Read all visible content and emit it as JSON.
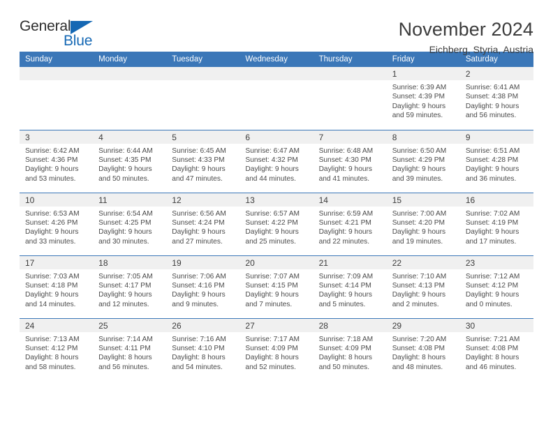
{
  "brand": {
    "name_dark": "General",
    "name_blue": "Blue",
    "triangle_icon": "triangle-icon",
    "accent_color": "#1568b4"
  },
  "header": {
    "title": "November 2024",
    "subtitle": "Eichberg, Styria, Austria",
    "header_bg_color": "#3b77b8",
    "daynum_bg_color": "#f0f0f0"
  },
  "weekdays": [
    "Sunday",
    "Monday",
    "Tuesday",
    "Wednesday",
    "Thursday",
    "Friday",
    "Saturday"
  ],
  "weeks": [
    [
      {
        "day": "",
        "empty": true
      },
      {
        "day": "",
        "empty": true
      },
      {
        "day": "",
        "empty": true
      },
      {
        "day": "",
        "empty": true
      },
      {
        "day": "",
        "empty": true
      },
      {
        "day": "1",
        "sunrise": "Sunrise: 6:39 AM",
        "sunset": "Sunset: 4:39 PM",
        "daylight_1": "Daylight: 9 hours",
        "daylight_2": "and 59 minutes."
      },
      {
        "day": "2",
        "sunrise": "Sunrise: 6:41 AM",
        "sunset": "Sunset: 4:38 PM",
        "daylight_1": "Daylight: 9 hours",
        "daylight_2": "and 56 minutes."
      }
    ],
    [
      {
        "day": "3",
        "sunrise": "Sunrise: 6:42 AM",
        "sunset": "Sunset: 4:36 PM",
        "daylight_1": "Daylight: 9 hours",
        "daylight_2": "and 53 minutes."
      },
      {
        "day": "4",
        "sunrise": "Sunrise: 6:44 AM",
        "sunset": "Sunset: 4:35 PM",
        "daylight_1": "Daylight: 9 hours",
        "daylight_2": "and 50 minutes."
      },
      {
        "day": "5",
        "sunrise": "Sunrise: 6:45 AM",
        "sunset": "Sunset: 4:33 PM",
        "daylight_1": "Daylight: 9 hours",
        "daylight_2": "and 47 minutes."
      },
      {
        "day": "6",
        "sunrise": "Sunrise: 6:47 AM",
        "sunset": "Sunset: 4:32 PM",
        "daylight_1": "Daylight: 9 hours",
        "daylight_2": "and 44 minutes."
      },
      {
        "day": "7",
        "sunrise": "Sunrise: 6:48 AM",
        "sunset": "Sunset: 4:30 PM",
        "daylight_1": "Daylight: 9 hours",
        "daylight_2": "and 41 minutes."
      },
      {
        "day": "8",
        "sunrise": "Sunrise: 6:50 AM",
        "sunset": "Sunset: 4:29 PM",
        "daylight_1": "Daylight: 9 hours",
        "daylight_2": "and 39 minutes."
      },
      {
        "day": "9",
        "sunrise": "Sunrise: 6:51 AM",
        "sunset": "Sunset: 4:28 PM",
        "daylight_1": "Daylight: 9 hours",
        "daylight_2": "and 36 minutes."
      }
    ],
    [
      {
        "day": "10",
        "sunrise": "Sunrise: 6:53 AM",
        "sunset": "Sunset: 4:26 PM",
        "daylight_1": "Daylight: 9 hours",
        "daylight_2": "and 33 minutes."
      },
      {
        "day": "11",
        "sunrise": "Sunrise: 6:54 AM",
        "sunset": "Sunset: 4:25 PM",
        "daylight_1": "Daylight: 9 hours",
        "daylight_2": "and 30 minutes."
      },
      {
        "day": "12",
        "sunrise": "Sunrise: 6:56 AM",
        "sunset": "Sunset: 4:24 PM",
        "daylight_1": "Daylight: 9 hours",
        "daylight_2": "and 27 minutes."
      },
      {
        "day": "13",
        "sunrise": "Sunrise: 6:57 AM",
        "sunset": "Sunset: 4:22 PM",
        "daylight_1": "Daylight: 9 hours",
        "daylight_2": "and 25 minutes."
      },
      {
        "day": "14",
        "sunrise": "Sunrise: 6:59 AM",
        "sunset": "Sunset: 4:21 PM",
        "daylight_1": "Daylight: 9 hours",
        "daylight_2": "and 22 minutes."
      },
      {
        "day": "15",
        "sunrise": "Sunrise: 7:00 AM",
        "sunset": "Sunset: 4:20 PM",
        "daylight_1": "Daylight: 9 hours",
        "daylight_2": "and 19 minutes."
      },
      {
        "day": "16",
        "sunrise": "Sunrise: 7:02 AM",
        "sunset": "Sunset: 4:19 PM",
        "daylight_1": "Daylight: 9 hours",
        "daylight_2": "and 17 minutes."
      }
    ],
    [
      {
        "day": "17",
        "sunrise": "Sunrise: 7:03 AM",
        "sunset": "Sunset: 4:18 PM",
        "daylight_1": "Daylight: 9 hours",
        "daylight_2": "and 14 minutes."
      },
      {
        "day": "18",
        "sunrise": "Sunrise: 7:05 AM",
        "sunset": "Sunset: 4:17 PM",
        "daylight_1": "Daylight: 9 hours",
        "daylight_2": "and 12 minutes."
      },
      {
        "day": "19",
        "sunrise": "Sunrise: 7:06 AM",
        "sunset": "Sunset: 4:16 PM",
        "daylight_1": "Daylight: 9 hours",
        "daylight_2": "and 9 minutes."
      },
      {
        "day": "20",
        "sunrise": "Sunrise: 7:07 AM",
        "sunset": "Sunset: 4:15 PM",
        "daylight_1": "Daylight: 9 hours",
        "daylight_2": "and 7 minutes."
      },
      {
        "day": "21",
        "sunrise": "Sunrise: 7:09 AM",
        "sunset": "Sunset: 4:14 PM",
        "daylight_1": "Daylight: 9 hours",
        "daylight_2": "and 5 minutes."
      },
      {
        "day": "22",
        "sunrise": "Sunrise: 7:10 AM",
        "sunset": "Sunset: 4:13 PM",
        "daylight_1": "Daylight: 9 hours",
        "daylight_2": "and 2 minutes."
      },
      {
        "day": "23",
        "sunrise": "Sunrise: 7:12 AM",
        "sunset": "Sunset: 4:12 PM",
        "daylight_1": "Daylight: 9 hours",
        "daylight_2": "and 0 minutes."
      }
    ],
    [
      {
        "day": "24",
        "sunrise": "Sunrise: 7:13 AM",
        "sunset": "Sunset: 4:12 PM",
        "daylight_1": "Daylight: 8 hours",
        "daylight_2": "and 58 minutes."
      },
      {
        "day": "25",
        "sunrise": "Sunrise: 7:14 AM",
        "sunset": "Sunset: 4:11 PM",
        "daylight_1": "Daylight: 8 hours",
        "daylight_2": "and 56 minutes."
      },
      {
        "day": "26",
        "sunrise": "Sunrise: 7:16 AM",
        "sunset": "Sunset: 4:10 PM",
        "daylight_1": "Daylight: 8 hours",
        "daylight_2": "and 54 minutes."
      },
      {
        "day": "27",
        "sunrise": "Sunrise: 7:17 AM",
        "sunset": "Sunset: 4:09 PM",
        "daylight_1": "Daylight: 8 hours",
        "daylight_2": "and 52 minutes."
      },
      {
        "day": "28",
        "sunrise": "Sunrise: 7:18 AM",
        "sunset": "Sunset: 4:09 PM",
        "daylight_1": "Daylight: 8 hours",
        "daylight_2": "and 50 minutes."
      },
      {
        "day": "29",
        "sunrise": "Sunrise: 7:20 AM",
        "sunset": "Sunset: 4:08 PM",
        "daylight_1": "Daylight: 8 hours",
        "daylight_2": "and 48 minutes."
      },
      {
        "day": "30",
        "sunrise": "Sunrise: 7:21 AM",
        "sunset": "Sunset: 4:08 PM",
        "daylight_1": "Daylight: 8 hours",
        "daylight_2": "and 46 minutes."
      }
    ]
  ]
}
